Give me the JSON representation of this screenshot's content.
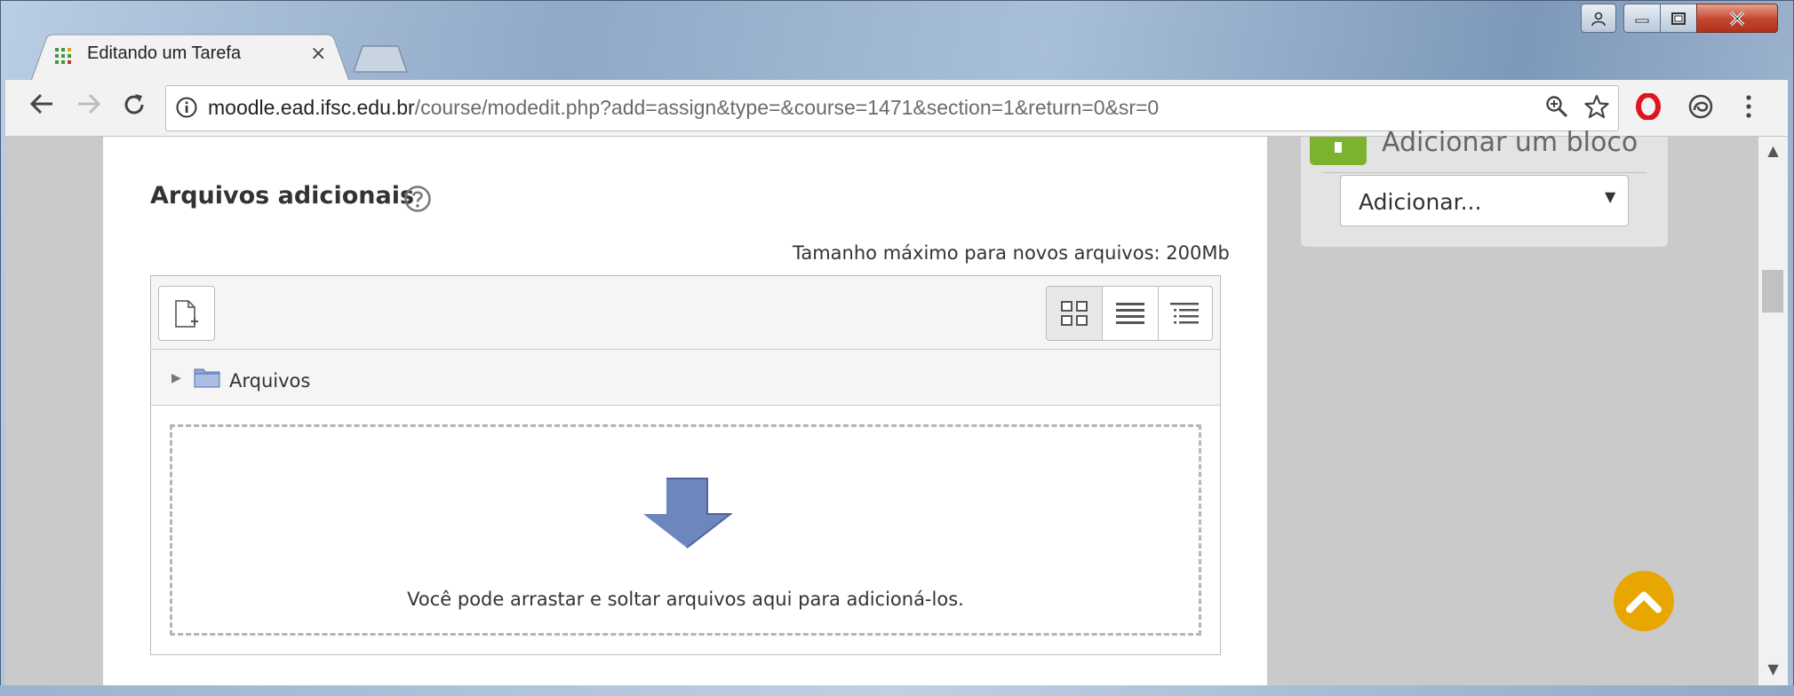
{
  "browser": {
    "tab_title": "Editando um Tarefa",
    "tab_close": "×",
    "url_host": "moodle.ead.ifsc.edu.br",
    "url_path": "/course/modedit.php?add=assign&type=&course=1471&section=1&return=0&sr=0",
    "icons": {
      "back": "arrow-left-icon",
      "forward": "arrow-right-icon",
      "reload": "reload-icon",
      "info": "info-icon",
      "zoom": "zoom-icon",
      "star": "star-icon",
      "opera": "opera-icon",
      "vpn": "vpn-icon",
      "menu": "kebab-menu-icon"
    }
  },
  "section": {
    "title": "Arquivos adicionais",
    "help_icon": "question-circle-icon",
    "max_size_text": "Tamanho máximo para novos arquivos: 200Mb"
  },
  "filemanager": {
    "path_label": "Arquivos",
    "drop_text": "Você pode arrastar e soltar arquivos aqui para adicioná-los.",
    "views": [
      "icons",
      "details",
      "tree"
    ]
  },
  "block": {
    "title": "Adicionar um bloco",
    "select_value": "Adicionar..."
  },
  "colors": {
    "accent_green": "#7bb32e",
    "back_to_top": "#e8a600",
    "drop_arrow": "#6d86bd"
  }
}
